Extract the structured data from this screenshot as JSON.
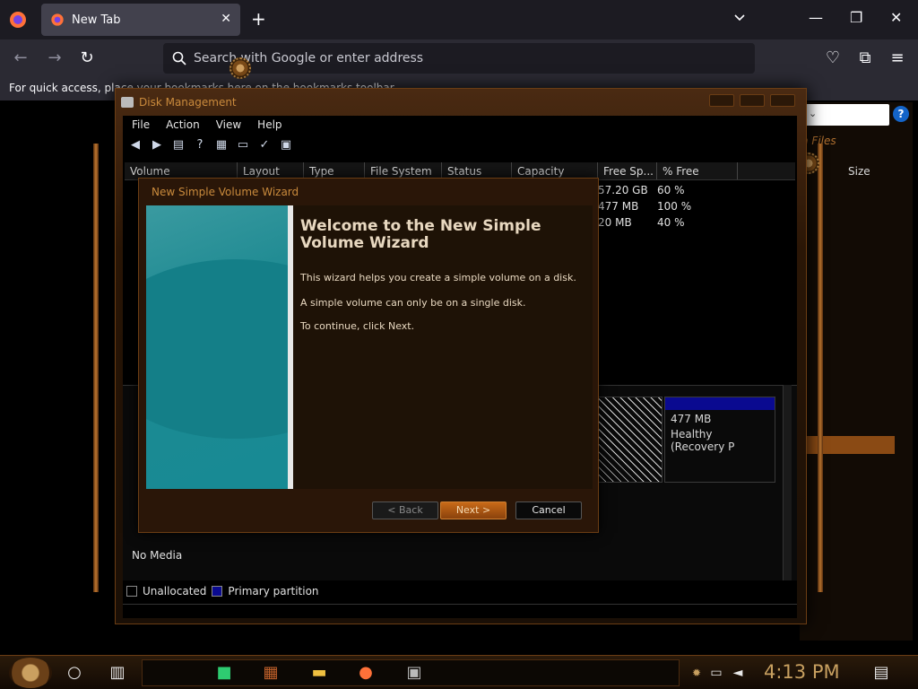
{
  "browser": {
    "tab_title": "New Tab",
    "url_placeholder": "Search with Google or enter address",
    "bookmarks_text": "For quick access, place your bookmarks here on the bookmarks toolbar."
  },
  "disk_management": {
    "title": "Disk Management",
    "menu": [
      "File",
      "Action",
      "View",
      "Help"
    ],
    "columns": [
      "Volume",
      "Layout",
      "Type",
      "File System",
      "Status",
      "Capacity",
      "Free Sp...",
      "% Free"
    ],
    "rows": [
      {
        "free": "57.20 GB",
        "pct": "60 %"
      },
      {
        "free": "477 MB",
        "pct": "100 %"
      },
      {
        "free": "20 MB",
        "pct": "40 %"
      }
    ],
    "recovery_size": "477 MB",
    "recovery_status": "Healthy (Recovery P",
    "no_media": "No Media",
    "legend": {
      "unallocated": "Unallocated",
      "primary": "Primary partition"
    }
  },
  "right_window": {
    "files_label": "n Files",
    "size_header": "Size",
    "help_icon": "?"
  },
  "wizard": {
    "title": "New Simple Volume Wizard",
    "heading": "Welcome to the New Simple Volume Wizard",
    "p1": "This wizard helps you create a simple volume on a disk.",
    "p2": "A simple volume can only be on a single disk.",
    "p3": "To continue, click Next.",
    "back": "< Back",
    "next": "Next >",
    "cancel": "Cancel"
  },
  "taskbar": {
    "time": "4:13 PM"
  },
  "colors": {
    "accent": "#c98a3c",
    "wizard_side": "#1e8a92",
    "primary_partition": "#0a0a90"
  }
}
